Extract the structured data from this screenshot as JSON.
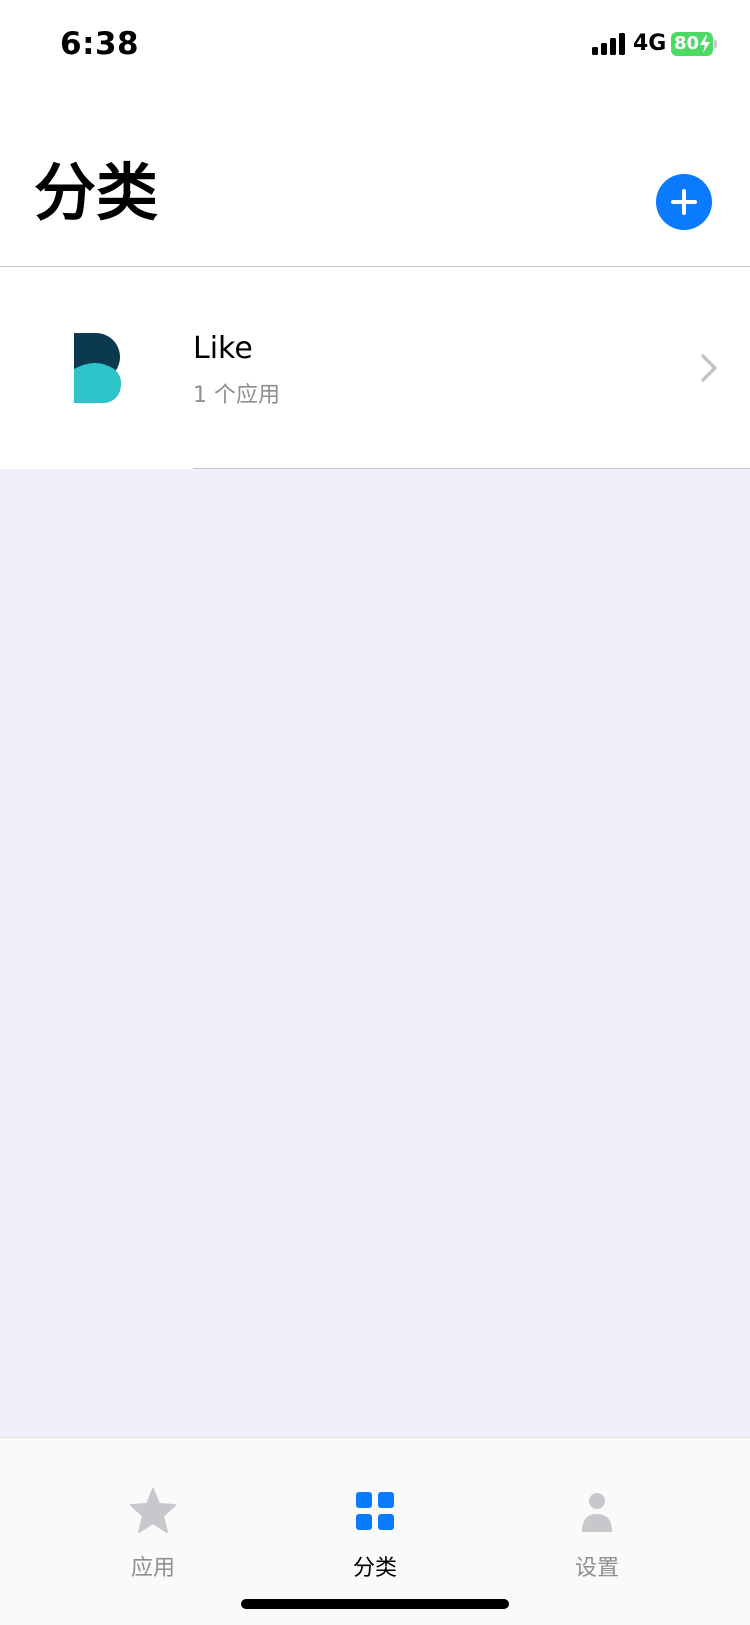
{
  "status_bar": {
    "time": "6:38",
    "network": "4G",
    "battery_level": "80",
    "battery_color": "#4cd964"
  },
  "header": {
    "title": "分类",
    "add_button_icon": "plus-circle-icon",
    "accent_color": "#0a7aff"
  },
  "categories": [
    {
      "name": "Like",
      "subtitle": "1 个应用",
      "icon": "b-logo-icon"
    }
  ],
  "tab_bar": {
    "tabs": [
      {
        "label": "应用",
        "icon": "star-icon",
        "active": false
      },
      {
        "label": "分类",
        "icon": "grid-icon",
        "active": true
      },
      {
        "label": "设置",
        "icon": "person-icon",
        "active": false
      }
    ]
  }
}
